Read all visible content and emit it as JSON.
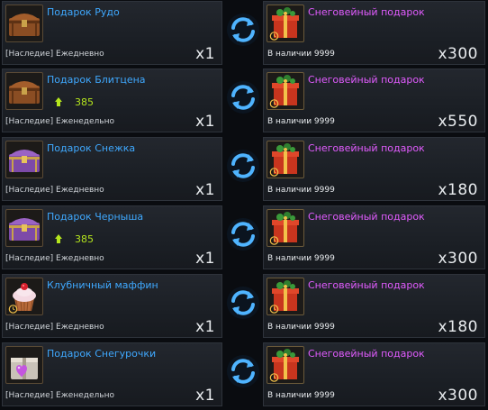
{
  "rows": [
    {
      "name": "Подарок Рудо",
      "icon": "chest-brown-icon",
      "req": null,
      "period": "[Наследие] Ежедневно",
      "give_qty": "x1",
      "reward_name": "Снеговейный подарок",
      "stock": "В наличии 9999",
      "reward_qty": "x300"
    },
    {
      "name": "Подарок Блитцена",
      "icon": "chest-brown-icon",
      "req": "385",
      "period": "[Наследие] Еженедельно",
      "give_qty": "x1",
      "reward_name": "Снеговейный подарок",
      "stock": "В наличии 9999",
      "reward_qty": "x550"
    },
    {
      "name": "Подарок Снежка",
      "icon": "chest-purple-icon",
      "req": null,
      "period": "[Наследие] Ежедневно",
      "give_qty": "x1",
      "reward_name": "Снеговейный подарок",
      "stock": "В наличии 9999",
      "reward_qty": "x180"
    },
    {
      "name": "Подарок Черныша",
      "icon": "chest-purple-icon",
      "req": "385",
      "period": "[Наследие] Ежедневно",
      "give_qty": "x1",
      "reward_name": "Снеговейный подарок",
      "stock": "В наличии 9999",
      "reward_qty": "x300"
    },
    {
      "name": "Клубничный маффин",
      "icon": "muffin-icon",
      "req": null,
      "period": "[Наследие] Ежедневно",
      "give_qty": "x1",
      "reward_name": "Снеговейный подарок",
      "stock": "В наличии 9999",
      "reward_qty": "x180"
    },
    {
      "name": "Подарок Снегурочки",
      "icon": "gift-box-heart-icon",
      "req": null,
      "period": "[Наследие] Еженедельно",
      "give_qty": "x1",
      "reward_name": "Снеговейный подарок",
      "stock": "В наличии 9999",
      "reward_qty": "x300"
    }
  ],
  "colors": {
    "item_name": "#3fa9ff",
    "reward_name": "#e25cff",
    "requirement": "#b5e61d",
    "swap_arrows": "#4fb4ff"
  },
  "icons": {
    "swap": "swap-arrows-icon",
    "requirement": "leaf-icon",
    "reward": "gift-present-icon",
    "timer": "timer-icon"
  }
}
